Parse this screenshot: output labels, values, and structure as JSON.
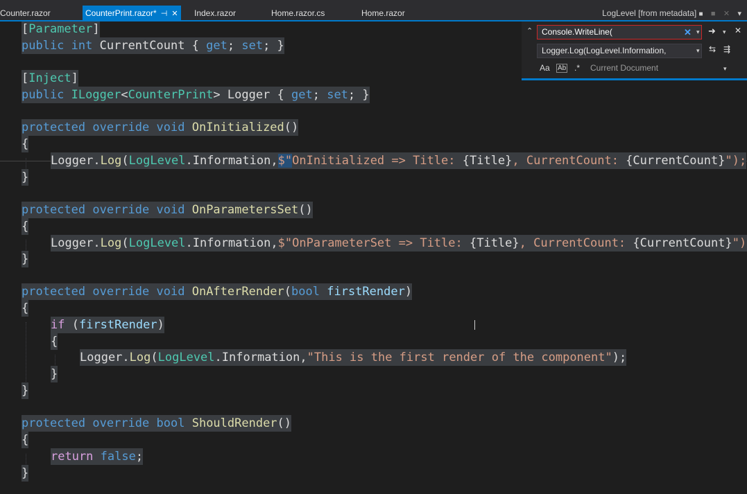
{
  "tabs": [
    {
      "label": "Counter.razor",
      "active": false
    },
    {
      "label": "CounterPrint.razor*",
      "active": true
    },
    {
      "label": "Index.razor",
      "active": false
    },
    {
      "label": "Home.razor.cs",
      "active": false
    },
    {
      "label": "Home.razor",
      "active": false
    }
  ],
  "tab_right": {
    "label": "LogLevel [from metadata]",
    "icon": "lock-icon"
  },
  "icons": {
    "pin": "⊣",
    "close": "✕",
    "lock": "🔒",
    "collapse": "⌃",
    "find_next": "➜",
    "dropdown": "▾",
    "replace_next": "⇆",
    "replace_all": "⇶"
  },
  "find": {
    "search_value": "Console.WriteLine(",
    "replace_value": "Logger.Log(LogLevel.Information,",
    "options": {
      "match_case": "Aa",
      "whole_word": "Ab",
      "regex": ".*"
    },
    "scope": "Current Document"
  },
  "code": {
    "l1": [
      "[",
      "Parameter",
      "]"
    ],
    "l2": [
      "public",
      " ",
      "int",
      " CurrentCount { ",
      "get",
      "; ",
      "set",
      "; }"
    ],
    "l3": [
      "[",
      "Inject",
      "]"
    ],
    "l4": [
      "public",
      " ",
      "ILogger",
      "<",
      "CounterPrint",
      "> Logger { ",
      "get",
      "; ",
      "set",
      "; }"
    ],
    "l5": [
      "protected",
      " ",
      "override",
      " ",
      "void",
      " ",
      "OnInitialized",
      "()"
    ],
    "l6": [
      "{"
    ],
    "l7": [
      "Logger",
      ".",
      "Log",
      "(",
      "LogLevel",
      ".",
      "Information",
      ",",
      "$\"",
      "OnInitialized => Title: ",
      "{Title}",
      ", CurrentCount: ",
      "{CurrentCount}",
      "\");"
    ],
    "l8": [
      "}"
    ],
    "l9": [
      "protected",
      " ",
      "override",
      " ",
      "void",
      " ",
      "OnParametersSet",
      "()"
    ],
    "l10": [
      "{"
    ],
    "l11": [
      "Logger",
      ".",
      "Log",
      "(",
      "LogLevel",
      ".",
      "Information",
      ",",
      "$\"",
      "OnParameterSet => Title: ",
      "{Title}",
      ", CurrentCount: ",
      "{CurrentCount}",
      "\");"
    ],
    "l12": [
      "}"
    ],
    "l13": [
      "protected",
      " ",
      "override",
      " ",
      "void",
      " ",
      "OnAfterRender",
      "(",
      "bool",
      " ",
      "firstRender",
      ")"
    ],
    "l14": [
      "{"
    ],
    "l15": [
      "if",
      " (",
      "firstRender",
      ")"
    ],
    "l16": [
      "{"
    ],
    "l17": [
      "Logger",
      ".",
      "Log",
      "(",
      "LogLevel",
      ".",
      "Information",
      ",",
      "\"This is the first render of the component\"",
      ");"
    ],
    "l18": [
      "}"
    ],
    "l19": [
      "}"
    ],
    "l20": [
      "protected",
      " ",
      "override",
      " ",
      "bool",
      " ",
      "ShouldRender",
      "()"
    ],
    "l21": [
      "{"
    ],
    "l22": [
      "return",
      " ",
      "false",
      ";"
    ],
    "l23": [
      "}"
    ]
  }
}
